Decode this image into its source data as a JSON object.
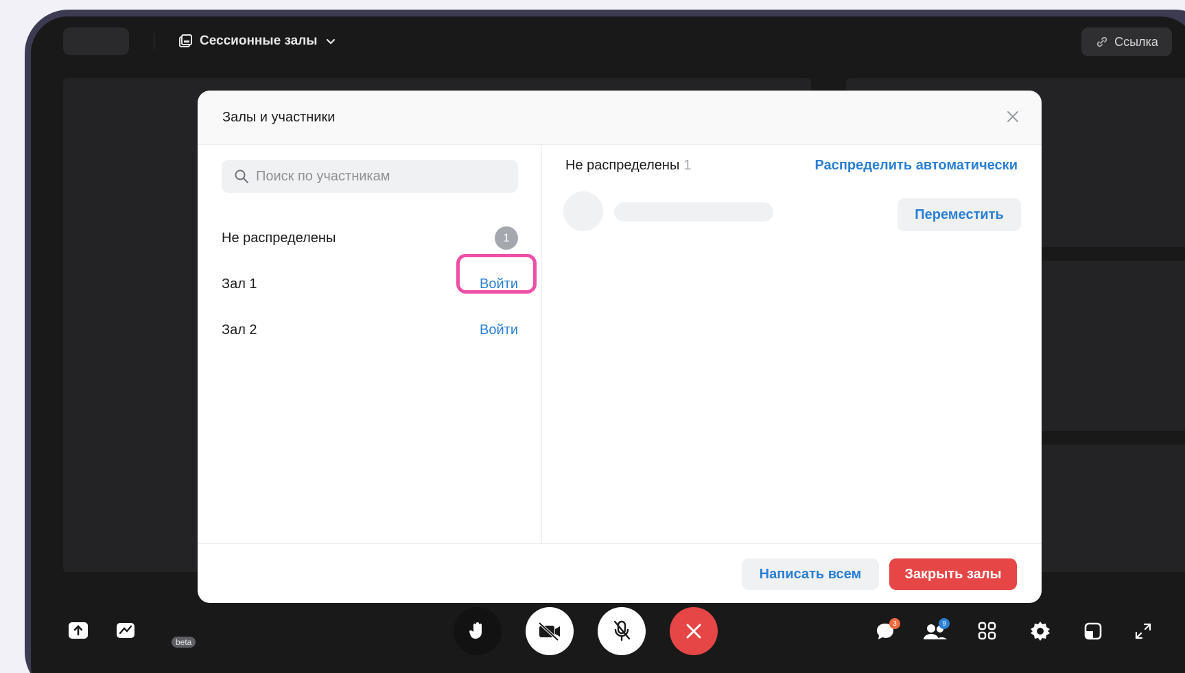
{
  "topbar": {
    "rooms_switch_label": "Сессионные залы",
    "link_label": "Ссылка"
  },
  "modal": {
    "title": "Залы и участники",
    "search": {
      "placeholder": "Поиск по участникам",
      "value": ""
    },
    "rooms": [
      {
        "label": "Не распределены",
        "badge": "1",
        "action": ""
      },
      {
        "label": "Зал 1",
        "badge": "",
        "action": "Войти"
      },
      {
        "label": "Зал 2",
        "badge": "",
        "action": "Войти"
      }
    ],
    "right": {
      "title": "Не распределены",
      "count": "1",
      "auto_distribute": "Распределить автоматически",
      "move_button": "Переместить"
    },
    "footer": {
      "write_all": "Написать всем",
      "close_rooms": "Закрыть залы"
    }
  },
  "toolbar": {
    "beta_label": "beta",
    "chat_badge": "3",
    "participants_badge": "9"
  },
  "colors": {
    "accent": "#2a7fd4",
    "danger": "#e64646",
    "highlight": "#ee4fa9",
    "frame": "#3c3b52"
  },
  "icons": [
    "layout-icon",
    "chevron-down-icon",
    "link-icon",
    "close-icon",
    "search-icon",
    "share-screen-icon",
    "whiteboard-icon",
    "hand-icon",
    "camera-off-icon",
    "mic-off-icon",
    "end-call-icon",
    "chat-icon",
    "participants-icon",
    "grid-icon",
    "gear-icon",
    "pip-icon",
    "fullscreen-icon"
  ]
}
